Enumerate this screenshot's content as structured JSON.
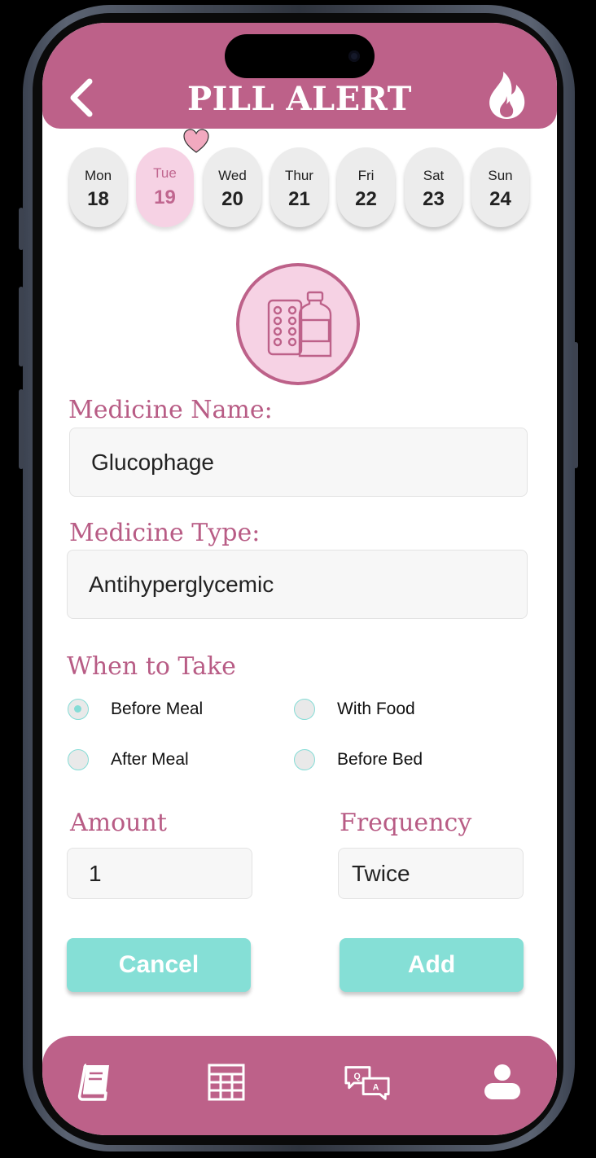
{
  "header": {
    "title": "PILL ALERT"
  },
  "calendar": {
    "days": [
      {
        "name": "Mon",
        "date": "18"
      },
      {
        "name": "Tue",
        "date": "19"
      },
      {
        "name": "Wed",
        "date": "20"
      },
      {
        "name": "Thur",
        "date": "21"
      },
      {
        "name": "Fri",
        "date": "22"
      },
      {
        "name": "Sat",
        "date": "23"
      },
      {
        "name": "Sun",
        "date": "24"
      }
    ],
    "selected": "Tue"
  },
  "form": {
    "medicine_name_label": "Medicine Name:",
    "medicine_name_value": "Glucophage",
    "medicine_type_label": "Medicine Type:",
    "medicine_type_value": "Antihyperglycemic",
    "when_label": "When to Take",
    "when_options": [
      "Before Meal",
      "With Food",
      "After Meal",
      "Before Bed"
    ],
    "when_selected": "Before Meal",
    "amount_label": "Amount",
    "amount_value": "1",
    "frequency_label": "Frequency",
    "frequency_value": "Twice"
  },
  "buttons": {
    "cancel": "Cancel",
    "add": "Add"
  },
  "nav": {
    "icons": [
      "book-icon",
      "calendar-grid-icon",
      "qa-chat-icon",
      "user-icon"
    ]
  },
  "colors": {
    "primary": "#bd6189",
    "accent": "#85dfd6",
    "selected_day_bg": "#f6d2e4"
  }
}
